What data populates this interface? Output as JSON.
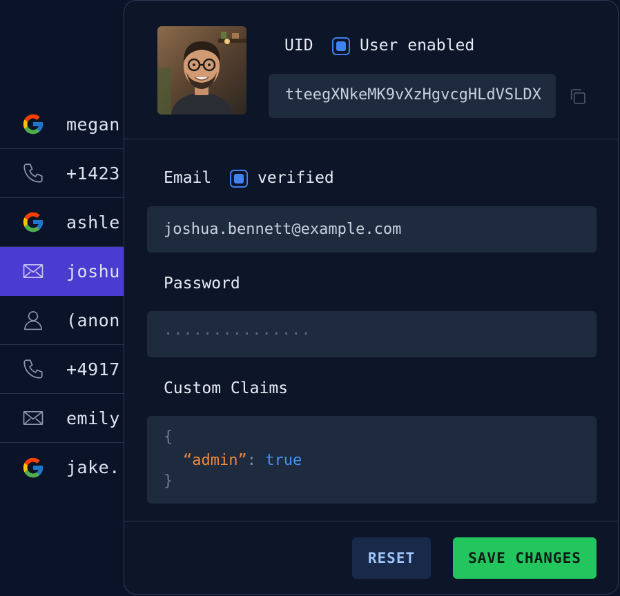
{
  "users": [
    {
      "provider": "google",
      "label": "megan"
    },
    {
      "provider": "phone",
      "label": "+1423"
    },
    {
      "provider": "google",
      "label": "ashle"
    },
    {
      "provider": "email",
      "label": "joshu"
    },
    {
      "provider": "anonymous",
      "label": "(anon"
    },
    {
      "provider": "phone",
      "label": "+4917"
    },
    {
      "provider": "email",
      "label": "emily"
    },
    {
      "provider": "google",
      "label": "jake."
    }
  ],
  "selected_index": 3,
  "panel": {
    "uid_label": "UID",
    "user_enabled_label": "User enabled",
    "user_enabled": true,
    "uid_value": "tteegXNkeMK9vXzHgvcgHLdVSLDX",
    "email_label": "Email",
    "verified_label": "verified",
    "email_verified": true,
    "email_value": "joshua.bennett@example.com",
    "password_label": "Password",
    "password_value": "···············",
    "claims_label": "Custom Claims",
    "claims": {
      "open": "{",
      "key": "“admin”",
      "colon": ": ",
      "value": "true",
      "close": "}"
    },
    "reset_label": "RESET",
    "save_label": "SAVE CHANGES"
  },
  "colors": {
    "background": "#0b1329",
    "selected_row": "#4a3bd1",
    "checkbox": "#4283f3",
    "save_button": "#22c55e",
    "claim_key": "#ef8a3a",
    "claim_value": "#4b8ff3"
  }
}
